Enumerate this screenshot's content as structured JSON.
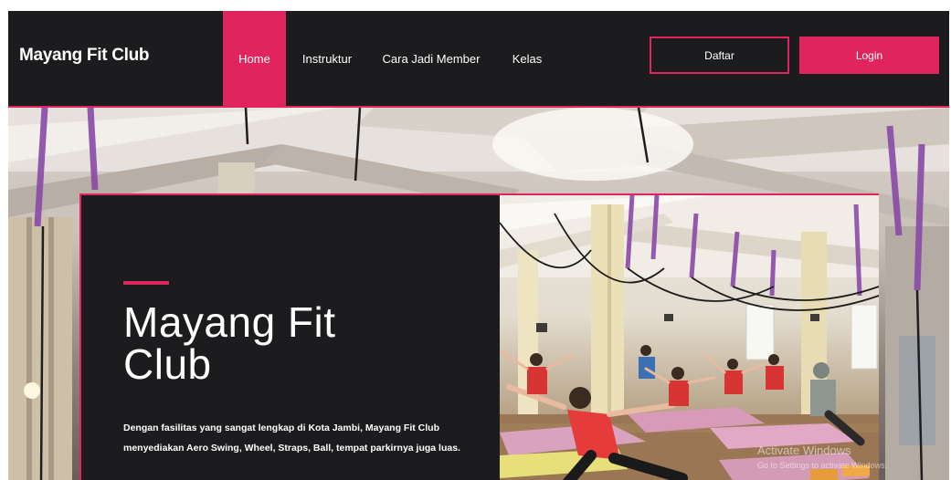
{
  "brand": {
    "name": "Mayang Fit Club"
  },
  "nav": {
    "items": [
      {
        "label": "Home",
        "active": true
      },
      {
        "label": "Instruktur",
        "active": false
      },
      {
        "label": "Cara Jadi Member",
        "active": false
      },
      {
        "label": "Kelas",
        "active": false
      }
    ],
    "register_label": "Daftar",
    "login_label": "Login"
  },
  "hero": {
    "title_line1": "Mayang Fit",
    "title_line2": "Club",
    "description_line1": "Dengan fasilitas yang sangat lengkap di Kota Jambi, Mayang Fit Club",
    "description_line2": "menyediakan Aero Swing, Wheel, Straps, Ball, tempat parkirnya juga luas."
  },
  "watermark": {
    "line1": "Activate Windows",
    "line2": "Go to Settings to activate Windows."
  },
  "colors": {
    "accent": "#e0245e",
    "dark": "#1c1b1d",
    "text": "#ffffff"
  }
}
